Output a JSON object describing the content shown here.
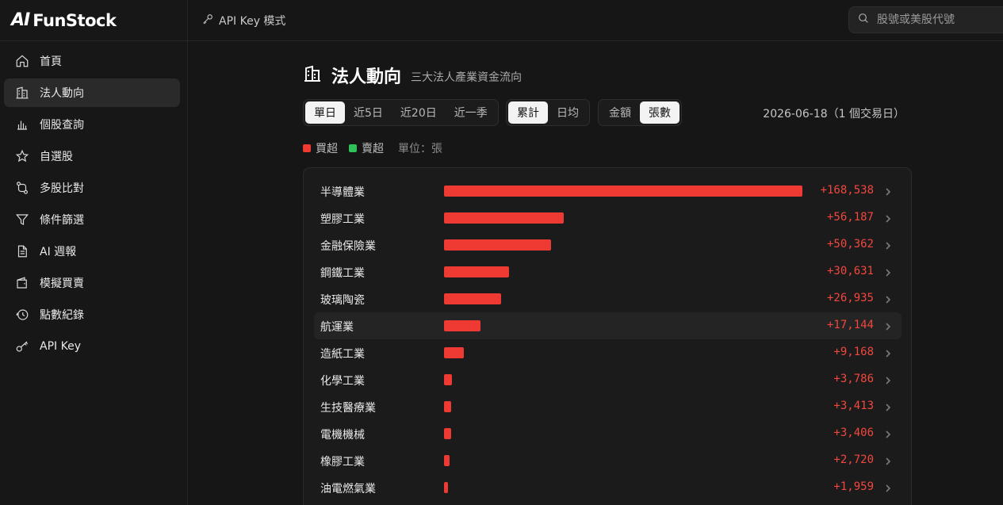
{
  "brand": {
    "mark": "AI",
    "name": "FunStock"
  },
  "topbar": {
    "apikey_mode": "API Key 模式",
    "search_placeholder": "股號或美股代號"
  },
  "sidebar": {
    "items": [
      {
        "label": "首頁",
        "icon": "home-icon"
      },
      {
        "label": "法人動向",
        "icon": "building-icon",
        "active": true
      },
      {
        "label": "個股查詢",
        "icon": "bar-chart-icon"
      },
      {
        "label": "自選股",
        "icon": "star-icon"
      },
      {
        "label": "多股比對",
        "icon": "compare-icon"
      },
      {
        "label": "條件篩選",
        "icon": "filter-icon"
      },
      {
        "label": "AI 週報",
        "icon": "document-icon"
      },
      {
        "label": "模擬買賣",
        "icon": "wallet-icon"
      },
      {
        "label": "點數紀錄",
        "icon": "history-icon"
      },
      {
        "label": "API Key",
        "icon": "key-icon"
      }
    ]
  },
  "page": {
    "title": "法人動向",
    "subtitle": "三大法人產業資金流向"
  },
  "controls": {
    "period": [
      {
        "label": "單日",
        "selected": true
      },
      {
        "label": "近5日",
        "selected": false
      },
      {
        "label": "近20日",
        "selected": false
      },
      {
        "label": "近一季",
        "selected": false
      }
    ],
    "mode": [
      {
        "label": "累計",
        "selected": true
      },
      {
        "label": "日均",
        "selected": false
      }
    ],
    "measure": [
      {
        "label": "金額",
        "selected": false
      },
      {
        "label": "張數",
        "selected": true
      }
    ],
    "date": "2026-06-18（1 個交易日）"
  },
  "legend": {
    "buy": "買超",
    "sell": "賣超",
    "unit": "單位：張",
    "buy_color": "#ef3a34",
    "sell_color": "#2fc05a"
  },
  "chart_data": {
    "type": "bar",
    "orientation": "horizontal",
    "unit": "張",
    "categories": [
      "半導體業",
      "塑膠工業",
      "金融保險業",
      "鋼鐵工業",
      "玻璃陶瓷",
      "航運業",
      "造紙工業",
      "化學工業",
      "生技醫療業",
      "電機機械",
      "橡膠工業",
      "油電燃氣業"
    ],
    "values": [
      168538,
      56187,
      50362,
      30631,
      26935,
      17144,
      9168,
      3786,
      3413,
      3406,
      2720,
      1959
    ],
    "labels": [
      "+168,538",
      "+56,187",
      "+50,362",
      "+30,631",
      "+26,935",
      "+17,144",
      "+9,168",
      "+3,786",
      "+3,413",
      "+3,406",
      "+2,720",
      "+1,959"
    ],
    "highlighted": "航運業",
    "bar_color": "#ef3a34"
  }
}
